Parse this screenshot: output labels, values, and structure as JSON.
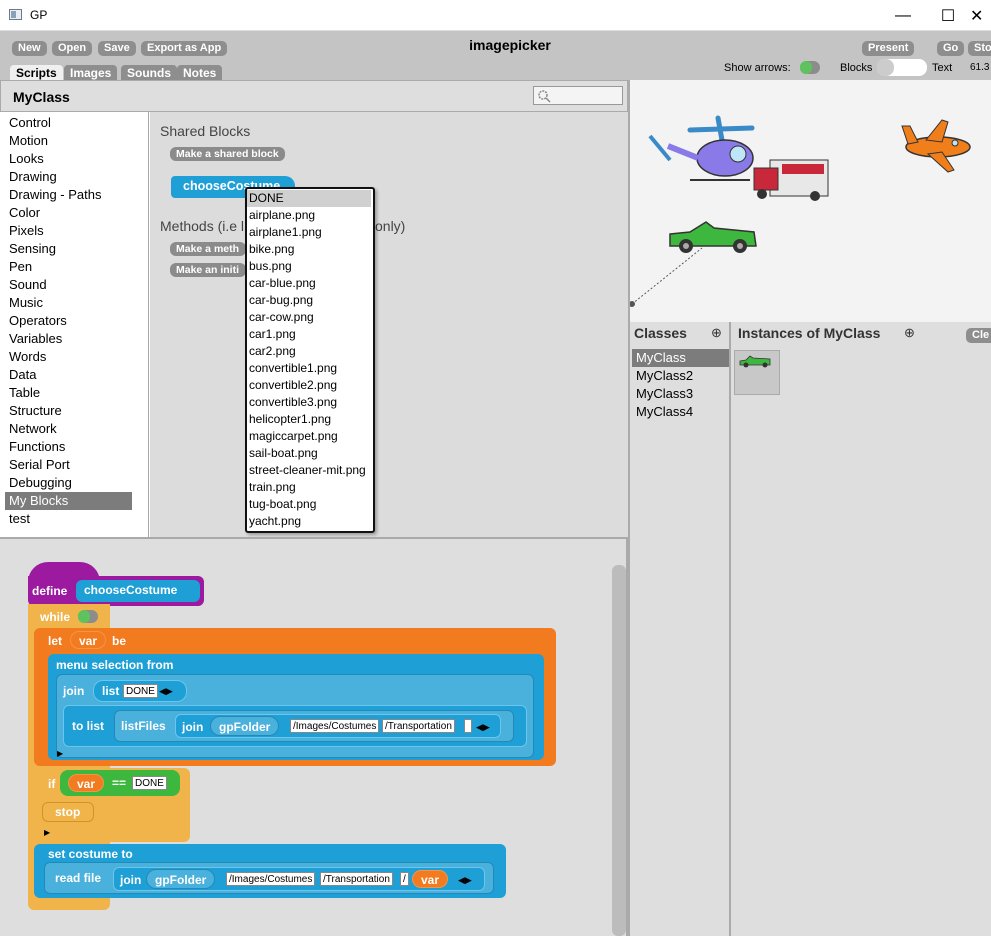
{
  "window": {
    "title": "GP",
    "minimize": "—",
    "maximize": "☐",
    "close": "✕"
  },
  "toolbar": {
    "new": "New",
    "open": "Open",
    "save": "Save",
    "export": "Export as App",
    "project_name": "imagepicker",
    "present": "Present",
    "go": "Go",
    "stop": "Sto",
    "show_arrows": "Show arrows:",
    "blocks": "Blocks",
    "text": "Text",
    "fps": "61.3"
  },
  "tabs": [
    "Scripts",
    "Images",
    "Sounds",
    "Notes"
  ],
  "class_name": "MyClass",
  "categories": [
    "Control",
    "Motion",
    "Looks",
    "Drawing",
    "Drawing - Paths",
    "Color",
    "Pixels",
    "Sensing",
    "Pen",
    "Sound",
    "Music",
    "Operators",
    "Variables",
    "Words",
    "Data",
    "Table",
    "Structure",
    "Network",
    "Functions",
    "Serial Port",
    "Debugging",
    "My Blocks",
    "test"
  ],
  "selected_category": "My Blocks",
  "palette": {
    "shared_title": "Shared Blocks",
    "make_shared": "Make a shared block",
    "shared_block": "chooseCostume",
    "methods_title": "Methods (i.e l",
    "methods_tail": "only)",
    "make_method": "Make a meth",
    "make_init": "Make an initi"
  },
  "menu": [
    "DONE",
    "airplane.png",
    "airplane1.png",
    "bike.png",
    "bus.png",
    "car-blue.png",
    "car-bug.png",
    "car-cow.png",
    "car1.png",
    "car2.png",
    "convertible1.png",
    "convertible2.png",
    "convertible3.png",
    "helicopter1.png",
    "magiccarpet.png",
    "sail-boat.png",
    "street-cleaner-mit.png",
    "train.png",
    "tug-boat.png",
    "yacht.png"
  ],
  "classes_panel": {
    "title": "Classes",
    "items": [
      "MyClass",
      "MyClass2",
      "MyClass3",
      "MyClass4"
    ],
    "selected": "MyClass"
  },
  "instances_panel": {
    "title": "Instances of MyClass",
    "clear": "Cle"
  },
  "script": {
    "define": "define",
    "block_name": "chooseCostume",
    "while": "while",
    "let": "let",
    "var": "var",
    "be": "be",
    "menu_selection": "menu selection from",
    "join": "join",
    "list": "list",
    "done": "DONE",
    "to_list": "to list",
    "list_files": "listFiles",
    "gp_folder": "gpFolder",
    "images_costumes": "/Images/Costumes",
    "transportation": "/Transportation",
    "if": "if",
    "eq": "==",
    "stop": "stop",
    "set_costume": "set costume to",
    "read_file": "read file",
    "slash": "/"
  },
  "colors": {
    "control": "#f0b44a",
    "define": "#9b1aa0",
    "variables": "#f27a1f",
    "my_blocks": "#1e9fd6",
    "operators": "#3eb73e"
  }
}
